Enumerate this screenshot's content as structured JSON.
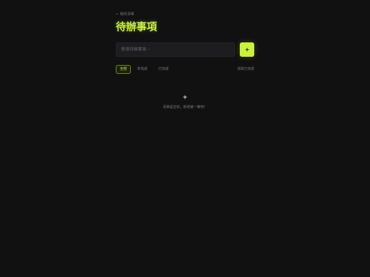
{
  "header": {
    "eyebrow": "← 我的清單",
    "title": "待辦事項"
  },
  "composer": {
    "placeholder": "新增待辦事項⋯",
    "value": "",
    "add_label": "+"
  },
  "filters": {
    "tabs": [
      {
        "label": "全部",
        "active": true
      },
      {
        "label": "未完成",
        "active": false
      },
      {
        "label": "已完成",
        "active": false
      }
    ],
    "clear_label": "清除已完成"
  },
  "empty_state": {
    "icon": "sparkle-icon",
    "glyph": "✦",
    "message": "清單是空的，新增第一筆吧！"
  },
  "colors": {
    "background": "#111112",
    "accent": "#c9f23a",
    "input_bg": "#1d1d20",
    "muted_text": "#7b7b7b"
  }
}
